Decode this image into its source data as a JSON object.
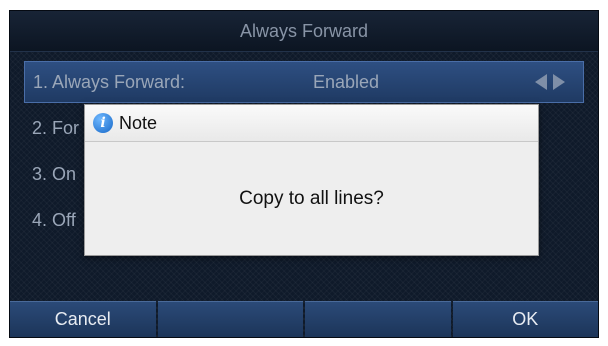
{
  "screen": {
    "title": "Always Forward"
  },
  "menu": {
    "items": [
      {
        "label": "1. Always Forward:",
        "value": "Enabled"
      },
      {
        "label": "2. For",
        "value": ""
      },
      {
        "label": "3. On",
        "value": ""
      },
      {
        "label": "4. Off",
        "value": ""
      }
    ]
  },
  "dialog": {
    "title": "Note",
    "icon": "info-icon",
    "message": "Copy to all lines?"
  },
  "softkeys": [
    "Cancel",
    "",
    "",
    "OK"
  ],
  "colors": {
    "screen_bg": "#0f1a2a",
    "selected_row": "#2e4f82",
    "softkey": "#2b4a78",
    "dialog_bg": "#eeeeee",
    "info_blue": "#1667c7"
  }
}
